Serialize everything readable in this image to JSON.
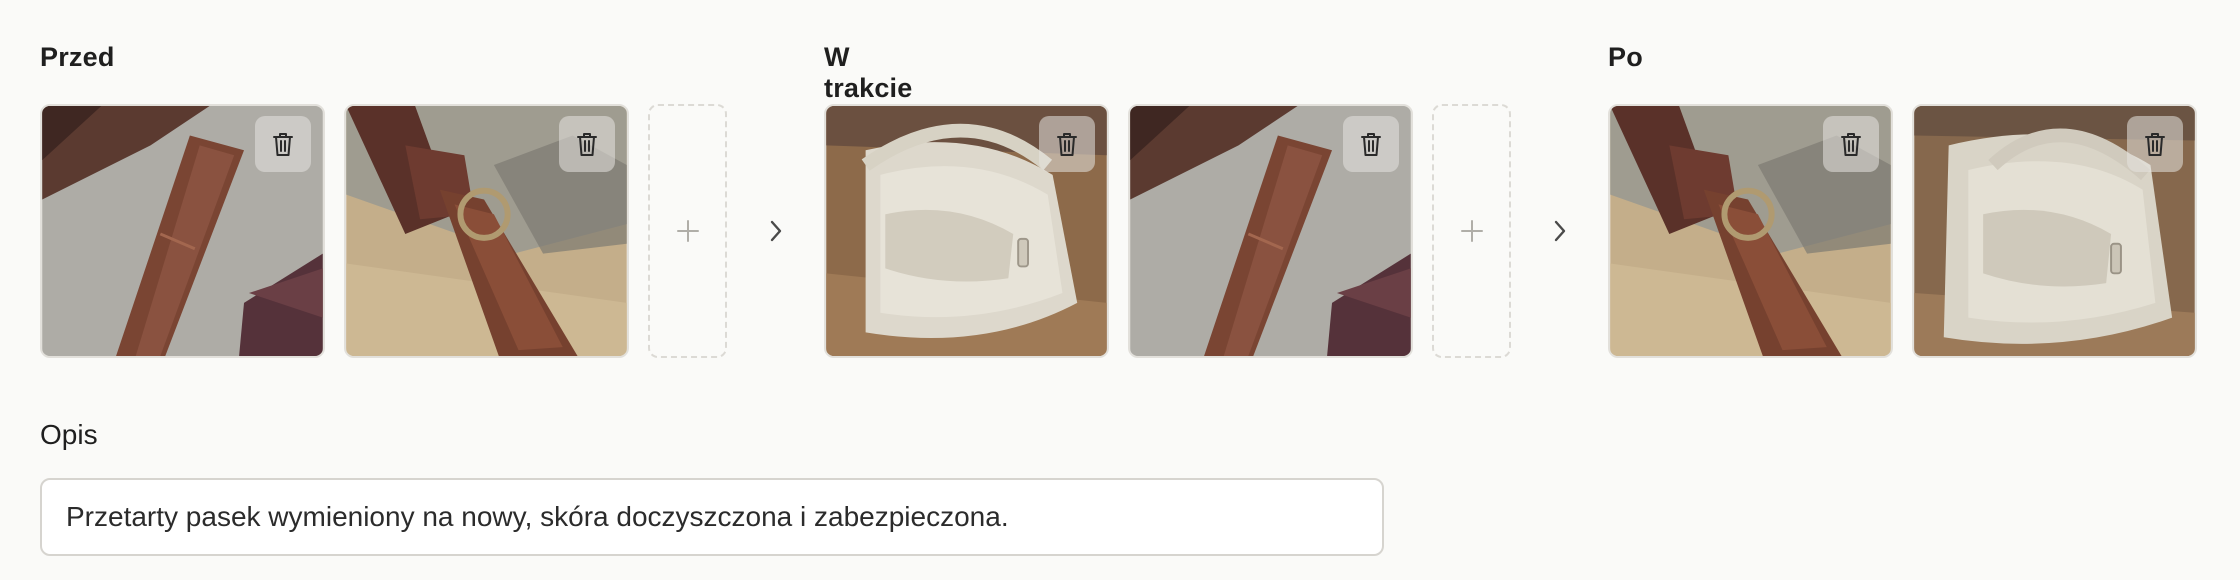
{
  "stages": [
    {
      "title": "Przed"
    },
    {
      "title": "W trakcie"
    },
    {
      "title": "Po"
    }
  ],
  "icons": {
    "delete": "trash-icon",
    "add": "plus-icon",
    "next": "chevron-right-icon"
  },
  "description": {
    "label": "Opis",
    "value": "Przetarty pasek wymieniony na nowy, skóra doczyszczona i zabezpieczona."
  }
}
